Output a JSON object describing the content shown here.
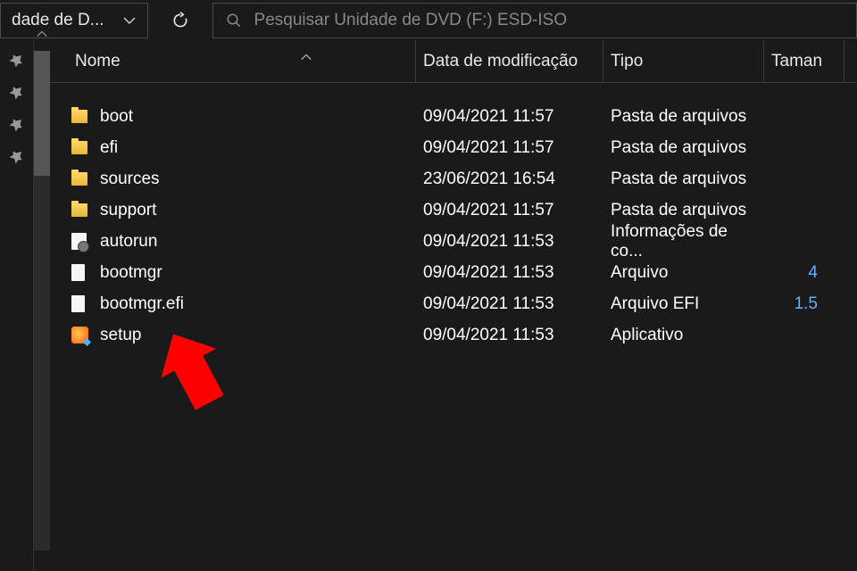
{
  "breadcrumb": {
    "label": "dade de D..."
  },
  "search": {
    "placeholder": "Pesquisar Unidade de DVD (F:) ESD-ISO"
  },
  "columns": {
    "name": "Nome",
    "date": "Data de modificação",
    "type": "Tipo",
    "size": "Taman"
  },
  "rows": [
    {
      "icon": "folder",
      "name": "boot",
      "date": "09/04/2021 11:57",
      "type": "Pasta de arquivos",
      "size": ""
    },
    {
      "icon": "folder",
      "name": "efi",
      "date": "09/04/2021 11:57",
      "type": "Pasta de arquivos",
      "size": ""
    },
    {
      "icon": "folder",
      "name": "sources",
      "date": "23/06/2021 16:54",
      "type": "Pasta de arquivos",
      "size": ""
    },
    {
      "icon": "folder",
      "name": "support",
      "date": "09/04/2021 11:57",
      "type": "Pasta de arquivos",
      "size": ""
    },
    {
      "icon": "gear",
      "name": "autorun",
      "date": "09/04/2021 11:53",
      "type": "Informações de co...",
      "size": ""
    },
    {
      "icon": "file",
      "name": "bootmgr",
      "date": "09/04/2021 11:53",
      "type": "Arquivo",
      "size": "4"
    },
    {
      "icon": "file",
      "name": "bootmgr.efi",
      "date": "09/04/2021 11:53",
      "type": "Arquivo EFI",
      "size": "1.5"
    },
    {
      "icon": "setup",
      "name": "setup",
      "date": "09/04/2021 11:53",
      "type": "Aplicativo",
      "size": ""
    }
  ]
}
